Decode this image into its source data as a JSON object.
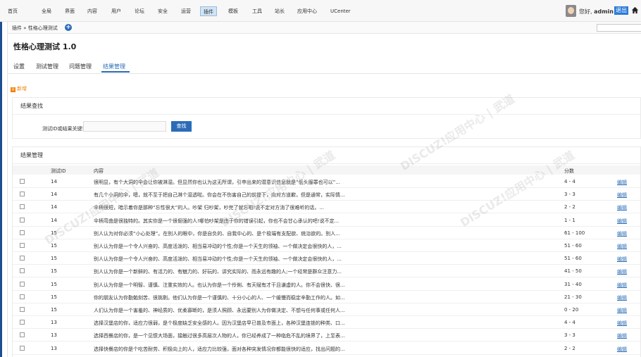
{
  "topnav": {
    "items": [
      "首页",
      "全局",
      "界面",
      "内容",
      "用户",
      "论坛",
      "安全",
      "运营",
      "插件",
      "模板",
      "工具",
      "站长",
      "应用中心",
      "UCenter"
    ],
    "active_index": 8,
    "greeting": "您好,",
    "username": "admin",
    "logout_label": "退出"
  },
  "crumb": {
    "text": "插件 » 性格心理测试"
  },
  "page": {
    "title": "性格心理测试 1.0"
  },
  "tabs": [
    "设置",
    "测试管理",
    "问题管理",
    "结果管理"
  ],
  "add_label": "新增",
  "search_panel": {
    "title": "结果查找",
    "field_label": "测试ID或结果关键词:",
    "button_label": "查找"
  },
  "manage_panel": {
    "title": "结果管理",
    "columns": {
      "id": "测试ID",
      "content": "内容",
      "score": "分数"
    },
    "edit_label": "编辑",
    "rows": [
      {
        "id": "14",
        "content": "很明显，有个大洞的伞会让你被淋湿。但显然你也认为这无所谓，引申出来的潜意识信息就是“低头服罪也可以”...",
        "score": "4 - 4"
      },
      {
        "id": "14",
        "content": "有几个小洞的伞，嗯，就不至于把自己淋个湿透啦。你会在不伤害自己的前提下，向对方道歉，但是通常，实际情...",
        "score": "3 - 3"
      },
      {
        "id": "14",
        "content": "伞柄很短，暗示着你是那种“忘性很大”的人。吵架 归吵架，吵完了就忘啦!说不定对方消了很难听的话，...",
        "score": "2 - 2"
      },
      {
        "id": "14",
        "content": "伞柄弯曲是很独特的。其实你是一个很倔强的人!哪怕吵架是由于你的错误引起，你也不会甘心承认的吧!说不定...",
        "score": "1 - 1"
      },
      {
        "id": "15",
        "content": "别人认为对你必须“小心处理”。在别人的眼中，你是自负的、自我中心的、是个极端有支配欲、统治欲的。别人...",
        "score": "61 - 100"
      },
      {
        "id": "15",
        "content": "别人认为你是一个令人兴奋的、高度活泼的、相当易冲动的个性;你是一个天生的领袖、一个做决定会很快的人，...",
        "score": "51 - 60"
      },
      {
        "id": "15",
        "content": "别人认为你是一个令人兴奋的、高度活泼的、相当易冲动的个性;你是一个天生的领袖、一个做决定会很快的人，...",
        "score": "51 - 60"
      },
      {
        "id": "15",
        "content": "别人认为你是一个新鲜的、有活力的、有魅力的、好玩的、讲究实际的、而永远有趣的人;一个经常是群众注意力...",
        "score": "41 - 50"
      },
      {
        "id": "15",
        "content": "别人认为你是一个明智、谨慎、注重实效的人。也认为你是一个伶俐、有天赋有才干且谦虚的人。你不会很快、很...",
        "score": "31 - 40"
      },
      {
        "id": "15",
        "content": "你的朋友认为你勤勉刻苦、很挑剔。他们认为你是一个谨慎的、十分小心的人、一个缓慢而稳定辛勤工作的人。如...",
        "score": "21 - 30"
      },
      {
        "id": "15",
        "content": "人们认为你是一个害羞的、神经质的、优柔寡断的，是须人照顾、永远要别人为你做决定、不想与任何事或任何人...",
        "score": "0 - 20"
      },
      {
        "id": "13",
        "content": "选择汉堡店的你，适应力很弱，是个极度缺乏安全感的人。因为汉堡店早已普及市面上，各种汉堡连锁的种类、口...",
        "score": "4 - 4"
      },
      {
        "id": "13",
        "content": "选择西餐店的你，是一个见惯大场面，接触过很多高层次人物的人，你已经养成了一种临危不乱的境界了，上至表...",
        "score": "3 - 3"
      },
      {
        "id": "13",
        "content": "选择快餐店的你是个吃苦耐劳、积极向上的人，适应力比较强，面对各种突发情况你都能很快的适应，找出问题的...",
        "score": "2 - 2"
      }
    ]
  },
  "watermark": {
    "text": "DISCUZ!应用中心 | 武道"
  }
}
